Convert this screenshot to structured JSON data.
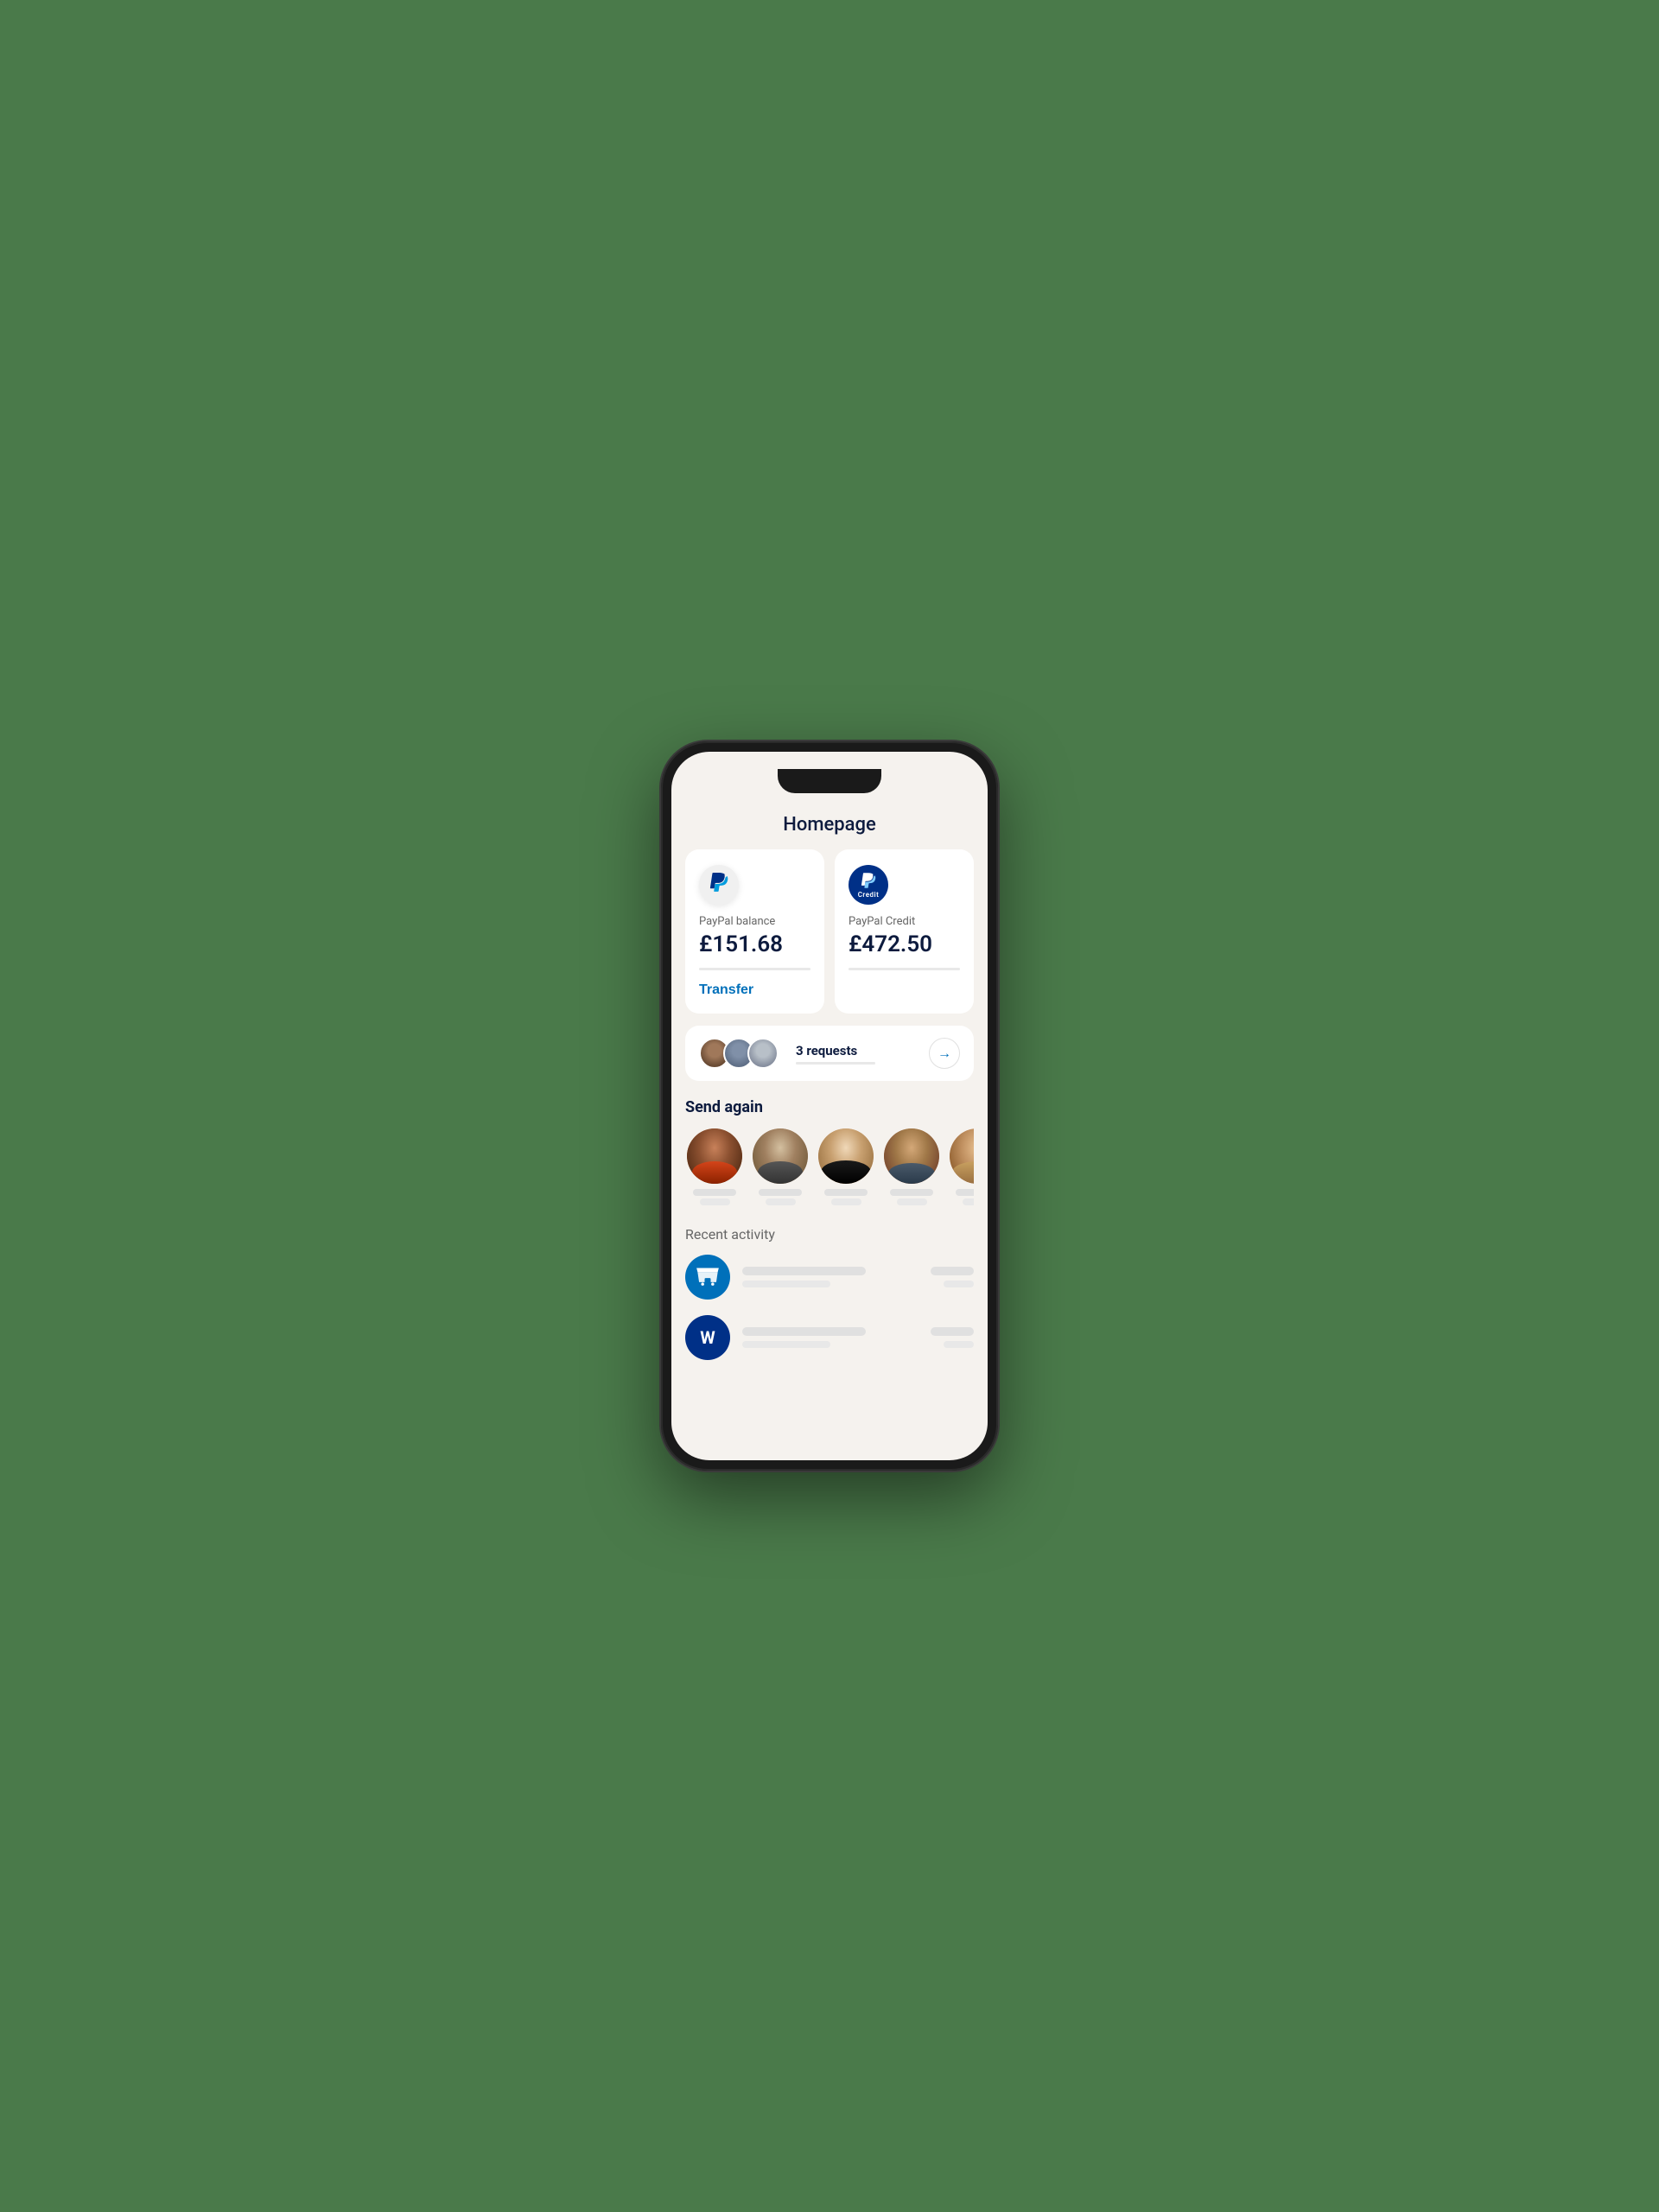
{
  "page": {
    "title": "Homepage",
    "background_color": "#4a7a4a"
  },
  "balance_cards": [
    {
      "id": "paypal-balance",
      "icon_type": "paypal_white_bg",
      "label": "PayPal balance",
      "amount": "£151.68",
      "has_transfer": true,
      "transfer_label": "Transfer"
    },
    {
      "id": "paypal-credit",
      "icon_type": "paypal_dark_bg",
      "label": "PayPal Credit",
      "amount": "£472.50",
      "has_transfer": false,
      "credit_text": "Credit"
    }
  ],
  "requests": {
    "count_text": "3 requests",
    "avatar_count": 3
  },
  "send_again": {
    "section_title": "Send again",
    "contacts": [
      {
        "id": 1,
        "css_class": "photo-avatar-1"
      },
      {
        "id": 2,
        "css_class": "photo-avatar-2"
      },
      {
        "id": 3,
        "css_class": "photo-avatar-3"
      },
      {
        "id": 4,
        "css_class": "photo-avatar-4"
      },
      {
        "id": 5,
        "css_class": "photo-avatar-5"
      }
    ]
  },
  "recent_activity": {
    "section_title": "Recent activity",
    "items": [
      {
        "id": 1,
        "icon_type": "store",
        "icon_letter": "",
        "color": "#0070ba"
      },
      {
        "id": 2,
        "icon_type": "letter",
        "icon_letter": "W",
        "color": "#003087"
      }
    ]
  },
  "icons": {
    "paypal_p": "P",
    "arrow_right": "→",
    "store_unicode": "🏪"
  }
}
